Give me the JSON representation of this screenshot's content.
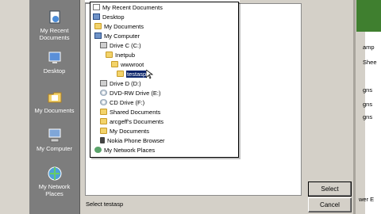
{
  "places": [
    {
      "label": "My Recent Documents",
      "icon": "recent-documents-icon"
    },
    {
      "label": "Desktop",
      "icon": "desktop-icon"
    },
    {
      "label": "My Documents",
      "icon": "my-documents-icon"
    },
    {
      "label": "My Computer",
      "icon": "my-computer-icon"
    },
    {
      "label": "My Network Places",
      "icon": "network-places-icon"
    }
  ],
  "dropdown_items": [
    {
      "label": "My Recent Documents",
      "icon": "doc"
    },
    {
      "label": "Desktop",
      "icon": "none"
    },
    {
      "label": "My Documents",
      "icon": "folder"
    },
    {
      "label": "My Computer",
      "icon": "pc"
    },
    {
      "label": "Drive C (C:)",
      "icon": "drive"
    },
    {
      "label": "Inetpub",
      "icon": "folder"
    },
    {
      "label": "wwwroot",
      "icon": "folder"
    },
    {
      "label": "testasp",
      "icon": "folder",
      "selected": true
    },
    {
      "label": "Drive D (D:)",
      "icon": "drive"
    },
    {
      "label": "DVD-RW Drive (E:)",
      "icon": "cd"
    },
    {
      "label": "CD Drive (F:)",
      "icon": "cd"
    },
    {
      "label": "Shared Documents",
      "icon": "folder"
    },
    {
      "label": "arcgeff's Documents",
      "icon": "folder"
    },
    {
      "label": "My Documents",
      "icon": "folder"
    },
    {
      "label": "Nokia Phone Browser",
      "icon": "phone"
    },
    {
      "label": "My Network Places",
      "icon": "net"
    }
  ],
  "status_label": "Select testasp",
  "buttons": {
    "select": "Select",
    "cancel": "Cancel"
  },
  "background_text": [
    "amp",
    "Shee",
    "gns",
    "gns",
    "gns",
    "wer E"
  ]
}
